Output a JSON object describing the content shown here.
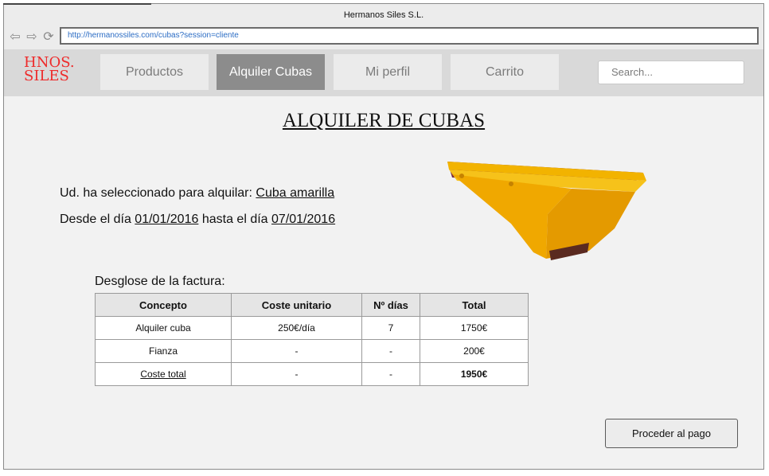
{
  "browser": {
    "title": "Hermanos Siles S.L.",
    "url": "http://hermanossiles.com/cubas?session=cliente",
    "nav_icons": [
      "back-arrow-icon",
      "forward-arrow-icon",
      "reload-icon"
    ]
  },
  "header": {
    "logo_line1": "HNOS.",
    "logo_line2": "SILES",
    "tabs": [
      {
        "label": "Productos",
        "active": false
      },
      {
        "label": "Alquiler Cubas",
        "active": true
      },
      {
        "label": "Mi perfil",
        "active": false
      },
      {
        "label": "Carrito",
        "active": false
      }
    ],
    "search_placeholder": "Search..."
  },
  "main": {
    "title": "ALQUILER DE CUBAS",
    "selection_prefix": "Ud. ha seleccionado para alquilar:",
    "selection_item": "Cuba amarilla",
    "dates_prefix": "Desde el día",
    "date_from": "01/01/2016",
    "dates_middle": "hasta el día",
    "date_to": "07/01/2016",
    "invoice_label": "Desglose de la factura:",
    "table": {
      "headers": [
        "Concepto",
        "Coste unitario",
        "Nº días",
        "Total"
      ],
      "rows": [
        [
          "Alquiler cuba",
          "250€/día",
          "7",
          "1750€"
        ],
        [
          "Fianza",
          "-",
          "-",
          "200€"
        ],
        [
          "Coste total",
          "-",
          "-",
          "1950€"
        ]
      ]
    },
    "pay_button": "Proceder al pago"
  },
  "colors": {
    "logo": "#ee2a2a",
    "active_tab": "#8c8c8c",
    "bin_yellow": "#f2b300",
    "bin_interior": "#7a2a3a"
  }
}
